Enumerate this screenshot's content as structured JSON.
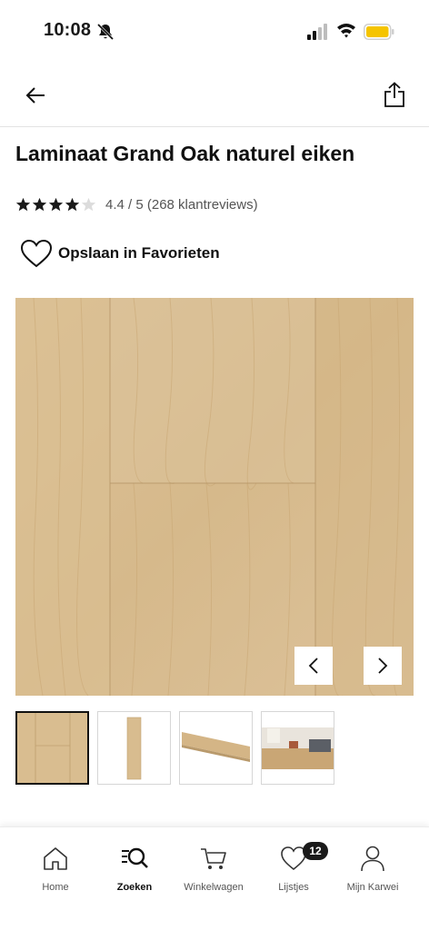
{
  "status_bar": {
    "time": "10:08",
    "icons": [
      "bell-muted-icon",
      "signal-icon",
      "wifi-icon",
      "battery-icon"
    ],
    "battery_color": "#F5C400"
  },
  "nav": {
    "back_icon": "arrow-left-icon",
    "share_icon": "share-icon"
  },
  "product": {
    "title": "Laminaat Grand Oak naturel eiken",
    "rating": 4.4,
    "stars_filled": 4,
    "stars_total": 5,
    "rating_text": "4.4 / 5 (268 klantreviews)"
  },
  "favorites": {
    "label": "Opslaan in Favorieten",
    "icon": "heart-outline-icon"
  },
  "gallery": {
    "thumbnail_count": 4,
    "active_index": 0,
    "prev_icon": "chevron-left-icon",
    "next_icon": "chevron-right-icon"
  },
  "bottom_nav": {
    "tabs": [
      {
        "label": "Home",
        "icon": "home-icon"
      },
      {
        "label": "Zoeken",
        "icon": "search-icon"
      },
      {
        "label": "Winkelwagen",
        "icon": "cart-icon"
      },
      {
        "label": "Lijstjes",
        "icon": "heart-icon",
        "badge": "12"
      },
      {
        "label": "Mijn Karwei",
        "icon": "user-icon"
      }
    ],
    "active_tab": "Zoeken"
  },
  "colors": {
    "wood": "#d9bd90",
    "text": "#111111",
    "accent": "#F5C400"
  }
}
